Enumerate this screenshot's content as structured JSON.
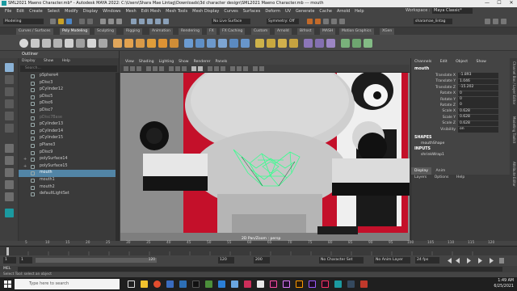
{
  "title_bar": {
    "title": "SML2021 Maeno Character.mb* - Autodesk MAYA 2022: C:\\Users\\Shara Mae Lintag\\Downloads\\3d character design\\SML2021 Maeno Character.mb  ---  mouth",
    "minimize": "—",
    "maximize": "☐",
    "close": "✕"
  },
  "menu_bar": {
    "items": [
      "File",
      "Edit",
      "Create",
      "Select",
      "Modify",
      "Display",
      "Windows",
      "Mesh",
      "Edit Mesh",
      "Mesh Tools",
      "Mesh Display",
      "Curves",
      "Surfaces",
      "Deform",
      "UV",
      "Generate",
      "Cache",
      "Arnold",
      "Help"
    ],
    "workspace_label": "Workspace :",
    "workspace_value": "Maya Classic*"
  },
  "status_line": {
    "mode": "Modeling",
    "live_surface": "No Live Surface",
    "symmetry": "Symmetry: Off",
    "user": "sharamae_lintag"
  },
  "shelf_tabs": [
    "Curves / Surfaces",
    "Poly Modeling",
    "Sculpting",
    "Rigging",
    "Animation",
    "Rendering",
    "FX",
    "FX Caching",
    "Custom",
    "Arnold",
    "Bifrost",
    "MASH",
    "Motion Graphics",
    "XGen"
  ],
  "active_shelf_tab": "Poly Modeling",
  "outliner": {
    "title": "Outliner",
    "menu": [
      "Display",
      "Show",
      "Help"
    ],
    "search_placeholder": "Search...",
    "items": [
      {
        "label": "pSphere4",
        "state": "normal",
        "expand": ""
      },
      {
        "label": "pDisc3",
        "state": "normal",
        "expand": ""
      },
      {
        "label": "pCylinder12",
        "state": "normal",
        "expand": ""
      },
      {
        "label": "pDisc5",
        "state": "normal",
        "expand": ""
      },
      {
        "label": "pDisc6",
        "state": "normal",
        "expand": ""
      },
      {
        "label": "pDisc7",
        "state": "normal",
        "expand": ""
      },
      {
        "label": "pDisc7Base",
        "state": "dim",
        "expand": ""
      },
      {
        "label": "pCylinder13",
        "state": "normal",
        "expand": ""
      },
      {
        "label": "pCylinder14",
        "state": "normal",
        "expand": ""
      },
      {
        "label": "pCylinder15",
        "state": "normal",
        "expand": ""
      },
      {
        "label": "pPlane3",
        "state": "normal",
        "expand": ""
      },
      {
        "label": "pDisc9",
        "state": "normal",
        "expand": ""
      },
      {
        "label": "polySurface14",
        "state": "normal",
        "expand": "+"
      },
      {
        "label": "polySurface15",
        "state": "normal",
        "expand": "+"
      },
      {
        "label": "mouth",
        "state": "selected",
        "expand": ""
      },
      {
        "label": "mouth1",
        "state": "normal",
        "expand": ""
      },
      {
        "label": "mouth2",
        "state": "normal",
        "expand": ""
      },
      {
        "label": "defaultLightSet",
        "state": "normal",
        "expand": ""
      }
    ]
  },
  "viewport": {
    "menu": [
      "View",
      "Shading",
      "Lighting",
      "Show",
      "Renderer",
      "Panels"
    ],
    "camera_label": "2D Pan/Zoom : persp"
  },
  "channel_box": {
    "menu": [
      "Channels",
      "Edit",
      "Object",
      "Show"
    ],
    "object": "mouth",
    "attributes": [
      {
        "name": "Translate X",
        "value": "-1.893"
      },
      {
        "name": "Translate Y",
        "value": "1.046"
      },
      {
        "name": "Translate Z",
        "value": "-15.202"
      },
      {
        "name": "Rotate X",
        "value": "0"
      },
      {
        "name": "Rotate Y",
        "value": "0"
      },
      {
        "name": "Rotate Z",
        "value": "0"
      },
      {
        "name": "Scale X",
        "value": "0.628"
      },
      {
        "name": "Scale Y",
        "value": "0.628"
      },
      {
        "name": "Scale Z",
        "value": "0.628"
      },
      {
        "name": "Visibility",
        "value": "on"
      }
    ],
    "shapes_label": "SHAPES",
    "shape_name": "mouthShape",
    "inputs_label": "INPUTS",
    "input_name": "shrinkWrap1",
    "layer_tabs": [
      "Display",
      "Anim"
    ],
    "layer_menu": [
      "Layers",
      "Options",
      "Help"
    ],
    "side_tabs": [
      "Channel Box / Layer Editor",
      "Modelling Toolkit",
      "Attribute Editor"
    ]
  },
  "time_slider": {
    "ticks": [
      "5",
      "10",
      "15",
      "20",
      "25",
      "30",
      "35",
      "40",
      "45",
      "50",
      "55",
      "60",
      "65",
      "70",
      "75",
      "80",
      "85",
      "90",
      "95",
      "100",
      "105",
      "110",
      "115",
      "120"
    ],
    "current_frame": "1"
  },
  "playback": {
    "start": "1",
    "range_start": "1",
    "range_display": "120",
    "range_end": "120",
    "end": "200",
    "character_set": "No Character Set",
    "anim_layer": "No Anim Layer",
    "fps": "24 fps"
  },
  "mel": {
    "label": "MEL",
    "help": "Select Tool: select an object"
  },
  "taskbar": {
    "search_placeholder": "Type here to search",
    "time": "1:49 AM",
    "date": "6/25/2021"
  },
  "colors": {
    "selection": "#5285a6",
    "viewport_red": "#c4102a",
    "mouth_wire": "#39ff8f",
    "maya_teal": "#1b9aa0"
  }
}
